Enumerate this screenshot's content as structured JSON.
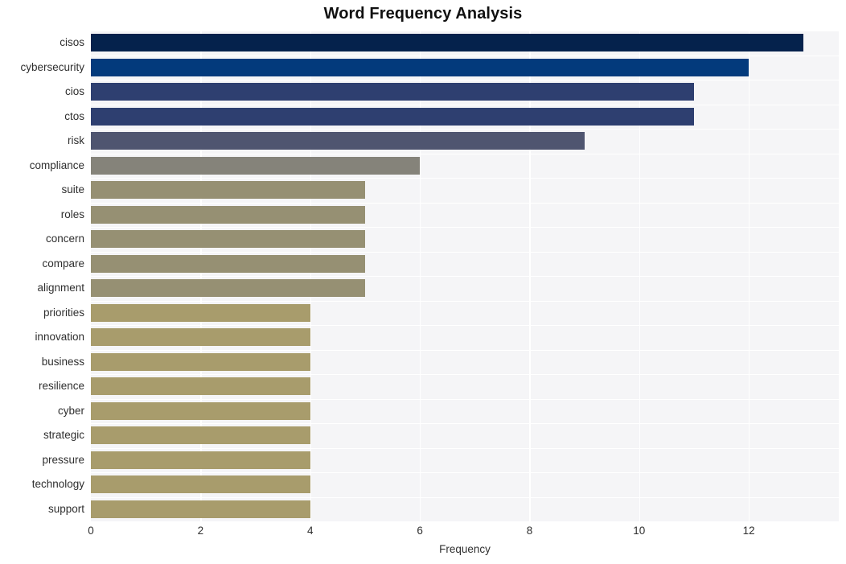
{
  "chart_data": {
    "type": "bar",
    "orientation": "horizontal",
    "title": "Word Frequency Analysis",
    "xlabel": "Frequency",
    "ylabel": "",
    "categories": [
      "cisos",
      "cybersecurity",
      "cios",
      "ctos",
      "risk",
      "compliance",
      "suite",
      "roles",
      "concern",
      "compare",
      "alignment",
      "priorities",
      "innovation",
      "business",
      "resilience",
      "cyber",
      "strategic",
      "pressure",
      "technology",
      "support"
    ],
    "values": [
      13,
      12,
      11,
      11,
      9,
      6,
      5,
      5,
      5,
      5,
      5,
      4,
      4,
      4,
      4,
      4,
      4,
      4,
      4,
      4
    ],
    "bar_colors": [
      "#05224c",
      "#033a7c",
      "#2e3f70",
      "#2e3f70",
      "#4f5570",
      "#85837a",
      "#969073",
      "#969073",
      "#969073",
      "#969073",
      "#969073",
      "#a89c6c",
      "#a89c6c",
      "#a89c6c",
      "#a89c6c",
      "#a89c6c",
      "#a89c6c",
      "#a89c6c",
      "#a89c6c",
      "#a89c6c"
    ],
    "xticks": [
      0,
      2,
      4,
      6,
      8,
      10,
      12
    ],
    "xtick_labels": [
      "0",
      "2",
      "4",
      "6",
      "8",
      "10",
      "12"
    ],
    "xlim": [
      0,
      13.64
    ],
    "grid": true,
    "grid_color": "#ffffff",
    "plot_background": "#f5f5f7",
    "figure_background": "#ffffff",
    "legend": null
  }
}
